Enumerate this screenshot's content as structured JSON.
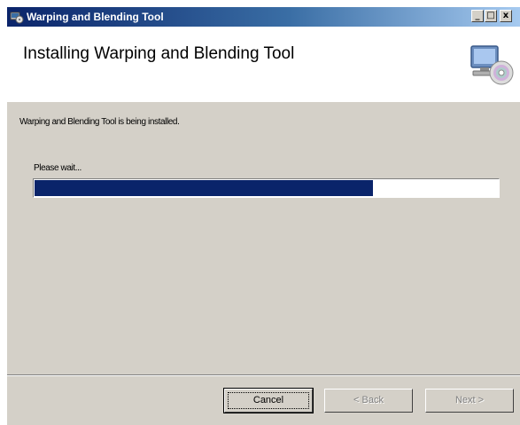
{
  "window": {
    "title": "Warping and Blending Tool"
  },
  "titlebar": {
    "minimize_glyph": "_",
    "maximize_glyph": "□",
    "close_glyph": "x"
  },
  "header": {
    "title": "Installing Warping and Blending Tool",
    "graphic_icon": "computer-cd-icon"
  },
  "body": {
    "status_text": "Warping and Blending Tool is being installed.",
    "wait_text": "Please wait...",
    "progress": 0.73
  },
  "buttons": {
    "cancel": "Cancel",
    "back": "< Back",
    "next": "Next >"
  },
  "colors": {
    "title_bar_start": "#0a246a",
    "title_bar_end": "#a6caf0",
    "progress_fill": "#0a246a",
    "window_bg": "#d4d0c8"
  }
}
